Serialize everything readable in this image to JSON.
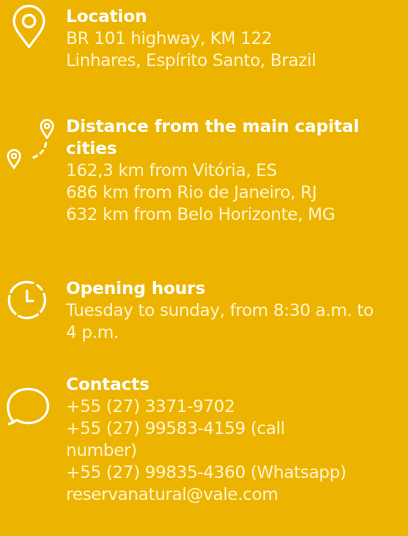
{
  "location": {
    "title": "Location",
    "lines": [
      "BR 101 highway, KM 122",
      "Linhares, Espírito Santo, Brazil"
    ]
  },
  "distance": {
    "title": "Distance from the main capital cities",
    "lines": [
      "162,3 km from Vitória, ES",
      "686 km from Rio de Janeiro, RJ",
      "632 km from Belo Horizonte, MG"
    ]
  },
  "hours": {
    "title": "Opening hours",
    "text": "Tuesday to sunday, from 8:30 a.m. to 4 p.m."
  },
  "contacts": {
    "title": "Contacts",
    "lines": [
      "+55 (27) 3371-9702",
      "+55 (27) 99583-4159 (call number)",
      "+55 (27) 99835-4360 (Whatsapp)",
      "reservanatural@vale.com"
    ]
  },
  "colors": {
    "background": "#ecb400",
    "title": "#ffffff",
    "body_text": "#fff5cf",
    "icon_stroke": "#ffffff"
  },
  "icons": [
    "location-pin-icon",
    "route-icon",
    "clock-icon",
    "chat-bubble-icon"
  ]
}
